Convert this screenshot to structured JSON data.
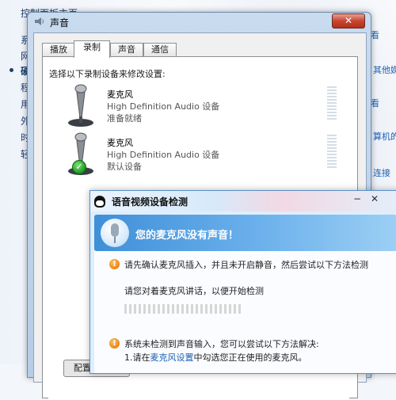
{
  "background": {
    "lines": [
      "控制面板主页",
      "系",
      "网",
      "硬",
      "程",
      "用",
      "外",
      "时",
      "轻"
    ],
    "right_links": [
      "看",
      "其他媒",
      "看",
      "算机的",
      "连接"
    ]
  },
  "sound_dialog": {
    "title": "声音",
    "close_label": "✕",
    "tabs": [
      "播放",
      "录制",
      "声音",
      "通信"
    ],
    "active_tab": "录制",
    "instruction": "选择以下录制设备来修改设置:",
    "devices": [
      {
        "name": "麦克风",
        "description": "High Definition Audio 设备",
        "status": "准备就绪",
        "icon": "microphone-icon",
        "default": false
      },
      {
        "name": "麦克风",
        "description": "High Definition Audio 设备",
        "status": "默认设备",
        "icon": "microphone-icon",
        "default": true
      }
    ],
    "bottom_button_label": "配置"
  },
  "qq_dialog": {
    "title": "语音视频设备检测",
    "controls": {
      "minimize": "−",
      "close": "✕"
    },
    "banner_text": "您的麦克风没有声音！",
    "step1": "请先确认麦克风插入，并且未开启静音，然后尝试以下方法检测",
    "prompt": "请您对着麦克风讲话，以便开始检测",
    "step2": "系统未检测到声音输入，您可以尝试以下方法解决:",
    "solution1_prefix": "1.请在",
    "solution1_link": "麦克风设置",
    "solution1_suffix": "中勾选您正在使用的麦克风。"
  },
  "colors": {
    "accent": "#1a5fb4",
    "banner": "#3f8fd8",
    "close_red": "#c8452f"
  }
}
